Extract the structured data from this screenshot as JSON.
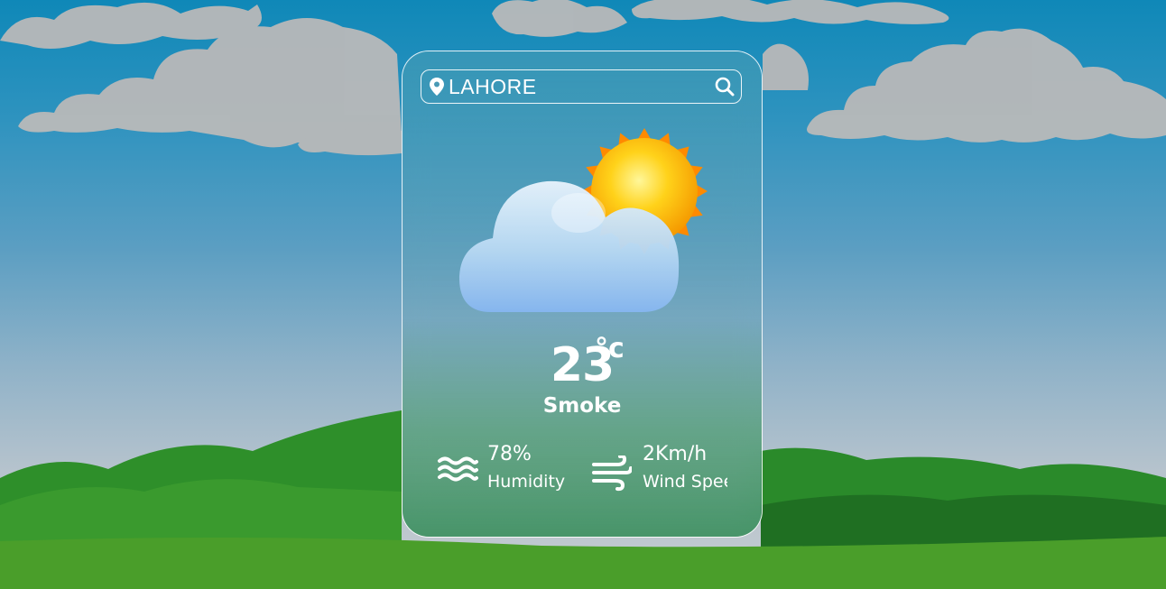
{
  "search": {
    "value": "LAHORE",
    "placeholder": "",
    "pin_icon": "map-pin-icon",
    "search_icon": "search-icon"
  },
  "weather": {
    "icon": "partly-cloudy-icon",
    "temperature": "23",
    "unit": "°c",
    "condition": "Smoke"
  },
  "humidity": {
    "value": "78%",
    "label": "Humidity",
    "icon": "humidity-waves-icon"
  },
  "wind": {
    "value": "2Km/h",
    "label": "Wind Speed",
    "icon": "wind-icon"
  },
  "colors": {
    "sky_top": "#0f88b8",
    "hill_green": "#2f8f2c",
    "text": "#ffffff"
  }
}
